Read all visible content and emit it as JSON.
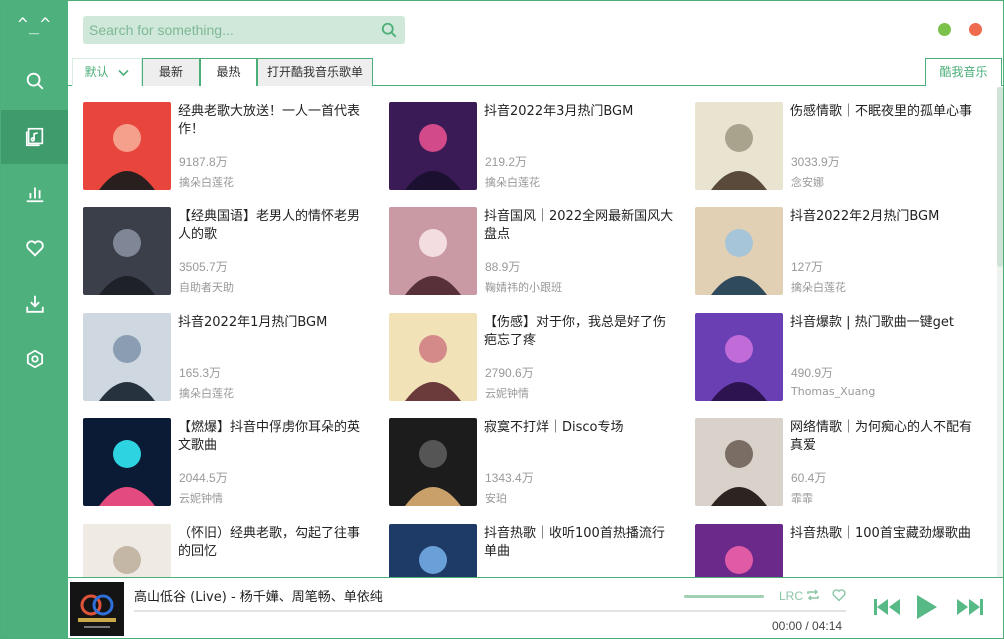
{
  "sidebar": {
    "logo": "^_^",
    "items": [
      {
        "icon": "search-icon"
      },
      {
        "icon": "music-library-icon",
        "active": true
      },
      {
        "icon": "chart-icon"
      },
      {
        "icon": "heart-icon"
      },
      {
        "icon": "download-icon"
      },
      {
        "icon": "settings-icon"
      }
    ]
  },
  "search": {
    "placeholder": "Search for something..."
  },
  "window": {
    "min_color": "#7cc149",
    "close_color": "#ef6b4f"
  },
  "tabs": {
    "default": "默认",
    "newest": "最新",
    "hottest": "最热",
    "open_playlist": "打开酷我音乐歌单",
    "source": "酷我音乐"
  },
  "playlists": [
    {
      "title": "经典老歌大放送！一人一首代表作！",
      "plays": "9187.8万",
      "author": "擒朵白莲花"
    },
    {
      "title": "抖音2022年3月热门BGM",
      "plays": "219.2万",
      "author": "擒朵白莲花"
    },
    {
      "title": "伤感情歌｜不眠夜里的孤单心事",
      "plays": "3033.9万",
      "author": "念安娜"
    },
    {
      "title": "【经典国语】老男人的情怀老男人的歌",
      "plays": "3505.7万",
      "author": "自助者天助"
    },
    {
      "title": "抖音国风｜2022全网最新国风大盘点",
      "plays": "88.9万",
      "author": "鞠婧祎的小跟班"
    },
    {
      "title": "抖音2022年2月热门BGM",
      "plays": "127万",
      "author": "擒朵白莲花"
    },
    {
      "title": "抖音2022年1月热门BGM",
      "plays": "165.3万",
      "author": "擒朵白莲花"
    },
    {
      "title": "【伤感】对于你，我总是好了伤疤忘了疼",
      "plays": "2790.6万",
      "author": "云妮钟情"
    },
    {
      "title": "抖音爆款 | 热门歌曲一键get",
      "plays": "490.9万",
      "author": "Thomas_Xuang"
    },
    {
      "title": "【燃爆】抖音中俘虏你耳朵的英文歌曲",
      "plays": "2044.5万",
      "author": "云妮钟情"
    },
    {
      "title": "寂寞不打烊｜Disco专场",
      "plays": "1343.4万",
      "author": "安珀"
    },
    {
      "title": "网络情歌｜为何痴心的人不配有真爱",
      "plays": "60.4万",
      "author": "霏霏"
    },
    {
      "title": "（怀旧）经典老歌，勾起了往事的回忆",
      "plays": "",
      "author": ""
    },
    {
      "title": "抖音热歌｜收听100首热播流行单曲",
      "plays": "",
      "author": ""
    },
    {
      "title": "抖音热歌｜100首宝藏劲爆歌曲",
      "plays": "",
      "author": ""
    }
  ],
  "player": {
    "title": "高山低谷 (Live) - 杨千嬅、周笔畅、单依纯",
    "lrc": "LRC",
    "time": "00:00 / 04:14",
    "progress": 0,
    "volume": 1.0,
    "accent": "#4caf7a"
  }
}
